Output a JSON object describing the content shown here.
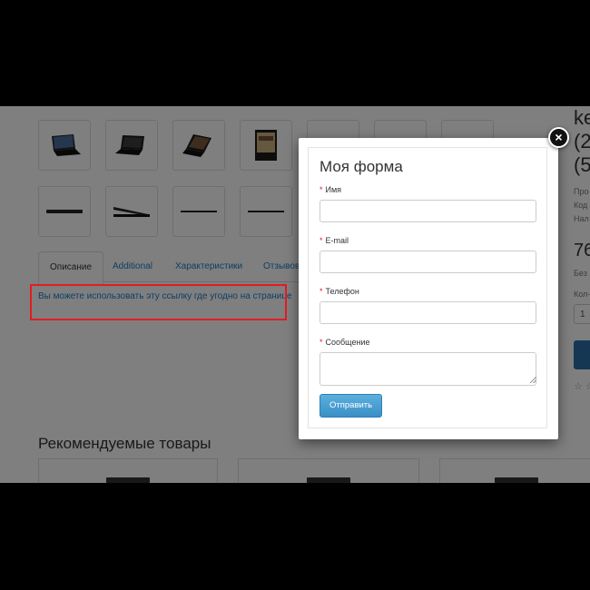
{
  "product": {
    "title_fragment": [
      "ke",
      "(2",
      "(5"
    ],
    "meta_fragments": [
      "Про",
      "Код",
      "Нал"
    ],
    "price_fragment": "76",
    "tax_fragment": "Без",
    "qty_label_fragment": "Кол-",
    "qty_value": "1",
    "rating_fragment": "☆ ☆"
  },
  "tabs": [
    {
      "label": "Описание",
      "active": true
    },
    {
      "label": "Additional",
      "active": false
    },
    {
      "label": "Характеристики",
      "active": false
    },
    {
      "label": "Отзывов",
      "active": false
    }
  ],
  "description": {
    "text": "Вы можете использовать эту ссылку где угодно на странице"
  },
  "recommended": {
    "title": "Рекомендуемые товары"
  },
  "modal": {
    "title": "Моя форма",
    "fields": [
      {
        "label": "Имя",
        "required": true,
        "type": "text",
        "value": ""
      },
      {
        "label": "E-mail",
        "required": true,
        "type": "text",
        "value": ""
      },
      {
        "label": "Телефон",
        "required": true,
        "type": "text",
        "value": ""
      },
      {
        "label": "Сообщение",
        "required": true,
        "type": "textarea",
        "value": ""
      }
    ],
    "submit_label": "Отправить",
    "close_icon": "×"
  },
  "colors": {
    "accent": "#1a7cc9",
    "required": "#e31b23",
    "button": "#3a8fc6",
    "highlight_box": "#e31b23"
  }
}
